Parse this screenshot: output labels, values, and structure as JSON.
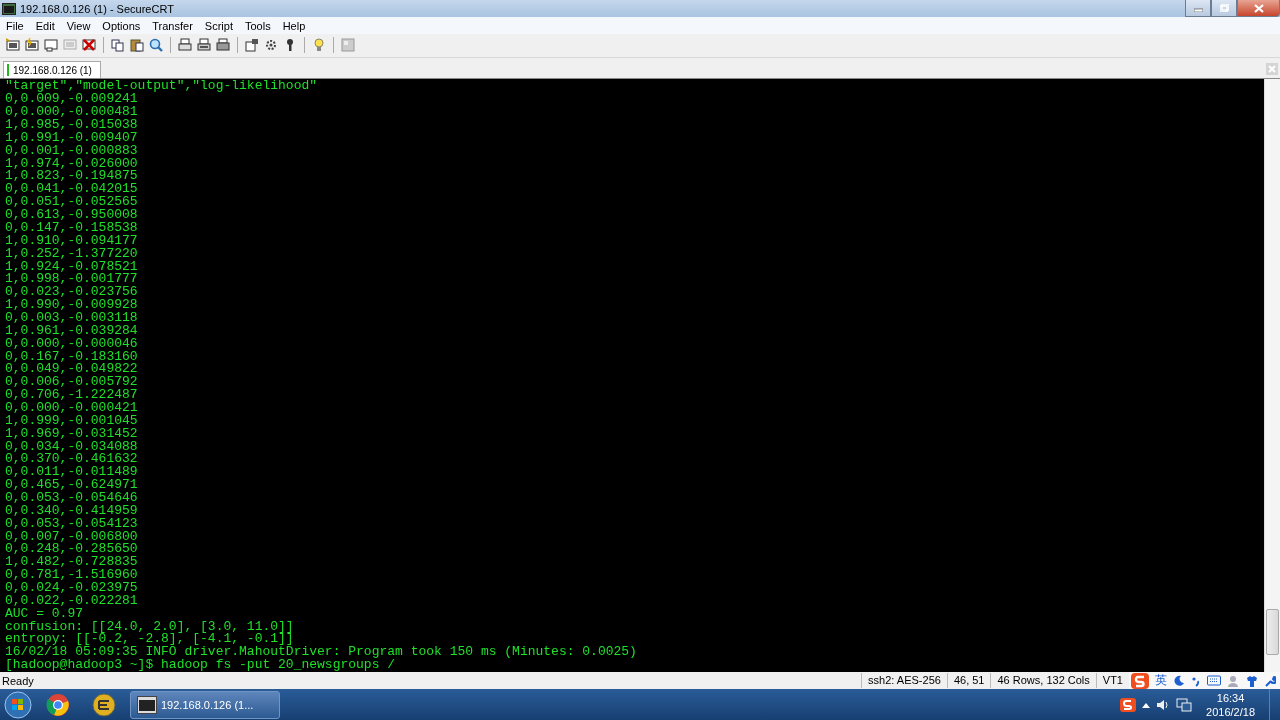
{
  "window": {
    "title": "192.168.0.126 (1) - SecureCRT"
  },
  "menu": [
    "File",
    "Edit",
    "View",
    "Options",
    "Transfer",
    "Script",
    "Tools",
    "Help"
  ],
  "tabs": [
    {
      "label": "192.168.0.126 (1)",
      "selected": true
    }
  ],
  "terminal": {
    "lines": [
      "\"target\",\"model-output\",\"log-likelihood\"",
      "0,0.009,-0.009241",
      "0,0.000,-0.000481",
      "1,0.985,-0.015038",
      "1,0.991,-0.009407",
      "0,0.001,-0.000883",
      "1,0.974,-0.026000",
      "1,0.823,-0.194875",
      "0,0.041,-0.042015",
      "0,0.051,-0.052565",
      "0,0.613,-0.950008",
      "0,0.147,-0.158538",
      "1,0.910,-0.094177",
      "1,0.252,-1.377220",
      "1,0.924,-0.078521",
      "1,0.998,-0.001777",
      "0,0.023,-0.023756",
      "1,0.990,-0.009928",
      "0,0.003,-0.003118",
      "1,0.961,-0.039284",
      "0,0.000,-0.000046",
      "0,0.167,-0.183160",
      "0,0.049,-0.049822",
      "0,0.006,-0.005792",
      "0,0.706,-1.222487",
      "0,0.000,-0.000421",
      "1,0.999,-0.001045",
      "1,0.969,-0.031452",
      "0,0.034,-0.034088",
      "0,0.370,-0.461632",
      "0,0.011,-0.011489",
      "0,0.465,-0.624971",
      "0,0.053,-0.054646",
      "0,0.340,-0.414959",
      "0,0.053,-0.054123",
      "0,0.007,-0.006800",
      "0,0.248,-0.285650",
      "1,0.482,-0.728835",
      "0,0.781,-1.516960",
      "0,0.024,-0.023975",
      "0,0.022,-0.022281",
      "AUC = 0.97",
      "confusion: [[24.0, 2.0], [3.0, 11.0]]",
      "entropy: [[-0.2, -2.8], [-4.1, -0.1]]",
      "16/02/18 05:09:35 INFO driver.MahoutDriver: Program took 150 ms (Minutes: 0.0025)",
      "[hadoop@hadoop3 ~]$ hadoop fs -put 20_newsgroups /"
    ]
  },
  "status_bar": {
    "message": "Ready",
    "cipher": "ssh2: AES-256",
    "cursor": "46, 51",
    "size": "46 Rows, 132 Cols",
    "emulation": "VT1"
  },
  "ime_bar": {
    "language": "英"
  },
  "taskbar": {
    "tasks": [
      {
        "label": "192.168.0.126 (1...",
        "selected": true
      }
    ],
    "clock": {
      "time": "16:34",
      "date": "2016/2/18"
    }
  }
}
